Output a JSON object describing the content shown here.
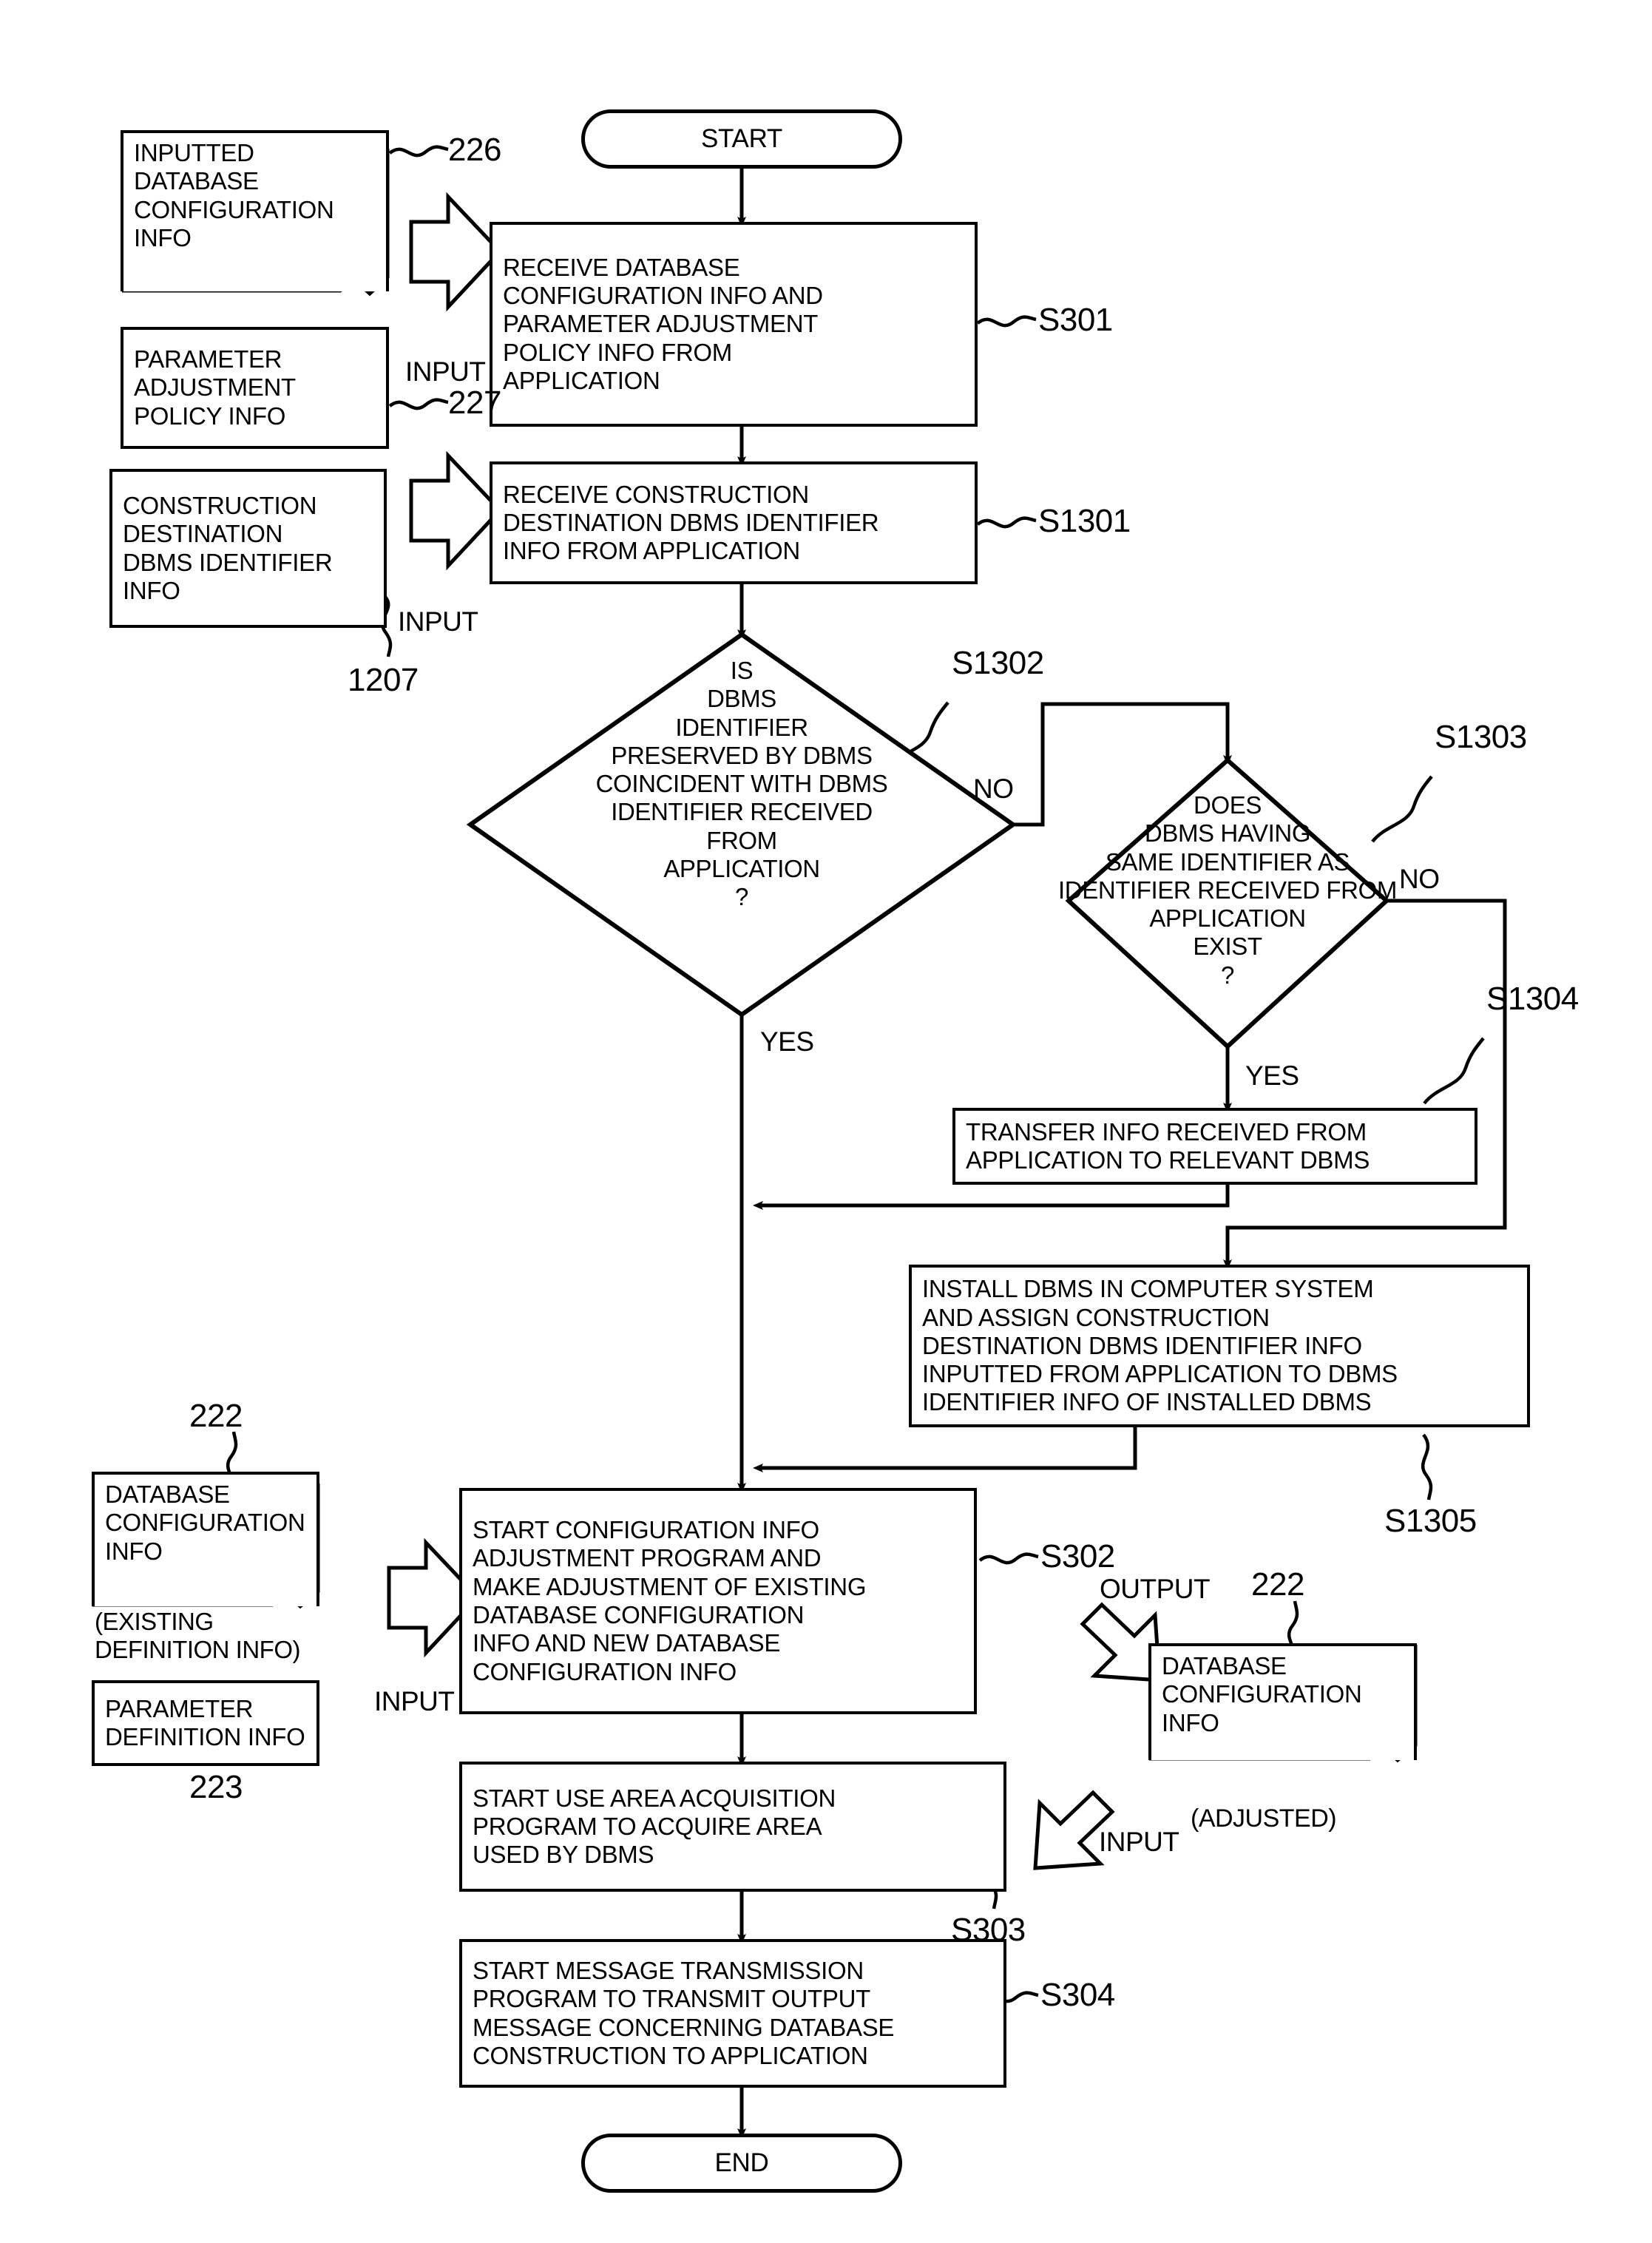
{
  "figure": {
    "type": "flowchart",
    "terminators": {
      "start": "START",
      "end": "END"
    },
    "process_steps": [
      {
        "ref": "S301",
        "text": "RECEIVE DATABASE\nCONFIGURATION INFO AND\nPARAMETER ADJUSTMENT\nPOLICY INFO FROM\nAPPLICATION"
      },
      {
        "ref": "S1301",
        "text": "RECEIVE CONSTRUCTION\nDESTINATION DBMS IDENTIFIER\nINFO FROM APPLICATION"
      },
      {
        "ref": "S1304",
        "text": "TRANSFER INFO RECEIVED FROM\nAPPLICATION TO RELEVANT DBMS"
      },
      {
        "ref": "S1305",
        "text": "INSTALL DBMS IN COMPUTER SYSTEM\nAND ASSIGN CONSTRUCTION\nDESTINATION DBMS IDENTIFIER INFO\nINPUTTED FROM APPLICATION TO DBMS\nIDENTIFIER INFO OF INSTALLED DBMS"
      },
      {
        "ref": "S302",
        "text": "START CONFIGURATION INFO\nADJUSTMENT PROGRAM AND\nMAKE ADJUSTMENT OF EXISTING\nDATABASE CONFIGURATION\nINFO AND NEW DATABASE\nCONFIGURATION INFO"
      },
      {
        "ref": "S303",
        "text": "START USE AREA ACQUISITION\nPROGRAM TO ACQUIRE AREA\nUSED BY DBMS"
      },
      {
        "ref": "S304",
        "text": "START MESSAGE TRANSMISSION\nPROGRAM TO TRANSMIT OUTPUT\nMESSAGE CONCERNING DATABASE\nCONSTRUCTION TO APPLICATION"
      }
    ],
    "decisions": [
      {
        "ref": "S1302",
        "text": "IS\nDBMS\nIDENTIFIER\nPRESERVED BY DBMS\nCOINCIDENT WITH DBMS\nIDENTIFIER RECEIVED\nFROM\nAPPLICATION\n?",
        "yes_label": "YES",
        "no_label": "NO"
      },
      {
        "ref": "S1303",
        "text": "DOES\nDBMS HAVING\nSAME IDENTIFIER AS\nIDENTIFIER RECEIVED FROM\nAPPLICATION\nEXIST\n?",
        "yes_label": "YES",
        "no_label": "NO"
      }
    ],
    "data_objects": [
      {
        "ref": "226",
        "shape": "document",
        "text": "INPUTTED\nDATABASE\nCONFIGURATION\nINFO"
      },
      {
        "ref": "227",
        "shape": "rectangle",
        "text": "PARAMETER\nADJUSTMENT\nPOLICY INFO"
      },
      {
        "ref": "1207",
        "shape": "rectangle",
        "text": "CONSTRUCTION\nDESTINATION\nDBMS IDENTIFIER\nINFO"
      },
      {
        "ref": "222",
        "shape": "document",
        "text": "DATABASE\nCONFIGURATION\nINFO",
        "qualifier": "(EXISTING\nDEFINITION INFO)"
      },
      {
        "ref": "223",
        "shape": "rectangle",
        "text": "PARAMETER\nDEFINITION INFO"
      },
      {
        "ref": "222",
        "shape": "document",
        "text": "DATABASE\nCONFIGURATION\nINFO",
        "qualifier": "(ADJUSTED)"
      }
    ],
    "flow_labels": {
      "input_1": "INPUT",
      "input_2": "INPUT",
      "input_3": "INPUT",
      "input_4": "INPUT",
      "output_1": "OUTPUT"
    },
    "reference_numerals": [
      "226",
      "227",
      "1207",
      "222",
      "223",
      "222"
    ],
    "step_numerals": [
      "S301",
      "S1301",
      "S1302",
      "S1303",
      "S1304",
      "S1305",
      "S302",
      "S303",
      "S304"
    ],
    "ink_color": "#000000",
    "background_color": "#ffffff"
  }
}
